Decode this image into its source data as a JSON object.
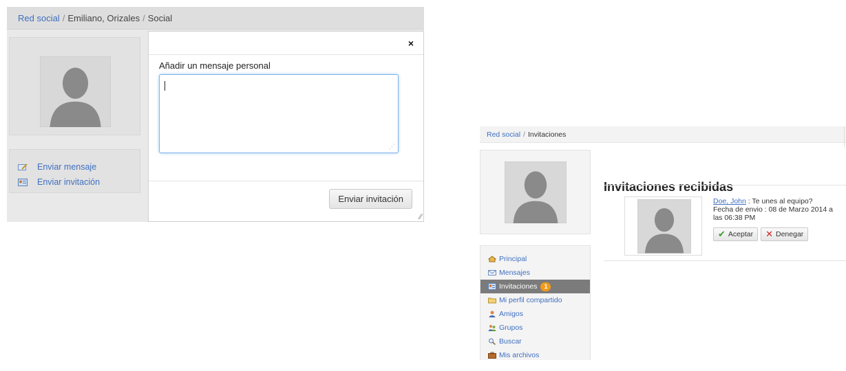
{
  "left": {
    "breadcrumb": {
      "root": "Red social",
      "sep": "/",
      "user": "Emiliano, Orizales",
      "section": "Social"
    },
    "actions": [
      {
        "label": "Enviar mensaje",
        "icon": "pencil-envelope-icon"
      },
      {
        "label": "Enviar invitación",
        "icon": "id-card-icon"
      }
    ],
    "modal": {
      "close": "×",
      "label": "Añadir un mensaje personal",
      "textarea_value": "",
      "send_label": "Enviar invitación"
    }
  },
  "right": {
    "breadcrumb": {
      "root": "Red social",
      "sep": "/",
      "section": "Invitaciones"
    },
    "menu": [
      {
        "label": "Principal",
        "icon": "home-icon"
      },
      {
        "label": "Mensajes",
        "icon": "envelope-icon"
      },
      {
        "label": "Invitaciones",
        "icon": "id-card-icon",
        "badge": "1",
        "active": true
      },
      {
        "label": "Mi perfil compartido",
        "icon": "folder-icon"
      },
      {
        "label": "Amigos",
        "icon": "user-icon"
      },
      {
        "label": "Grupos",
        "icon": "group-icon"
      },
      {
        "label": "Buscar",
        "icon": "magnifier-icon"
      },
      {
        "label": "Mis archivos",
        "icon": "briefcase-icon"
      }
    ],
    "title": "Invitaciones recibidas",
    "invitation": {
      "sender": "Doe, John",
      "message": " : Te unes al equipo?",
      "date_line": "Fecha de envio : 08 de Marzo 2014 a las 06:38 PM",
      "accept_label": "Aceptar",
      "deny_label": "Denegar"
    }
  },
  "colors": {
    "link": "#3f6fc0",
    "active_menu": "#7b7b7b",
    "badge": "#f29a1a",
    "focus_border": "#7fb0e6"
  }
}
